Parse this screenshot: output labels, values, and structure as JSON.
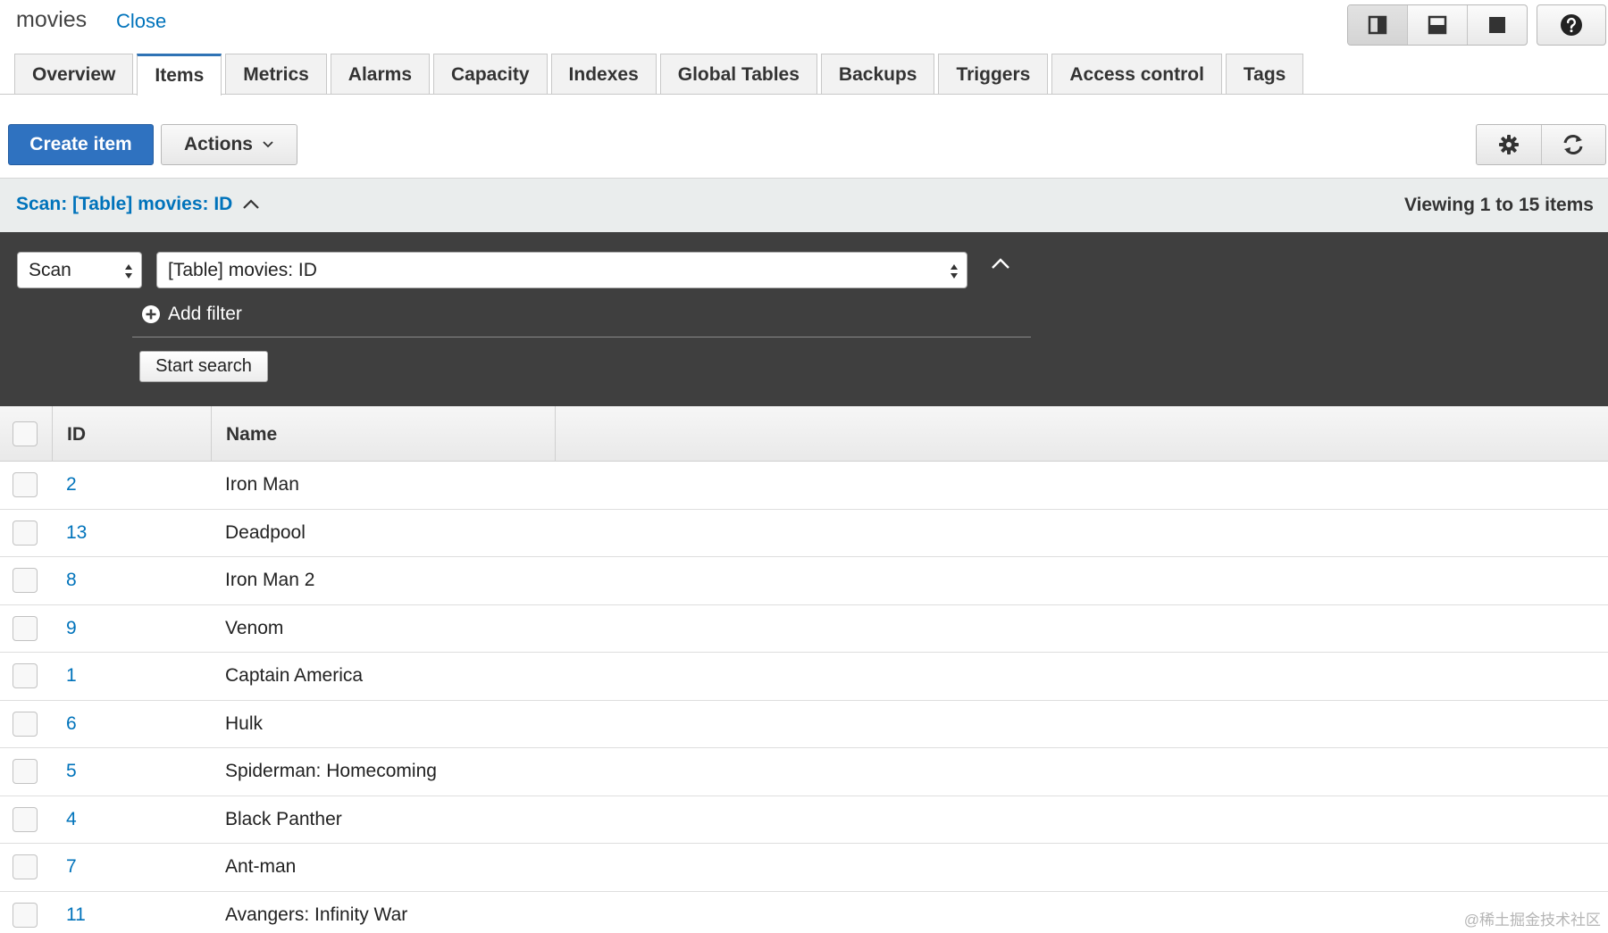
{
  "header": {
    "title": "movies",
    "close_label": "Close"
  },
  "tabs": [
    {
      "label": "Overview",
      "active": false
    },
    {
      "label": "Items",
      "active": true
    },
    {
      "label": "Metrics",
      "active": false
    },
    {
      "label": "Alarms",
      "active": false
    },
    {
      "label": "Capacity",
      "active": false
    },
    {
      "label": "Indexes",
      "active": false
    },
    {
      "label": "Global Tables",
      "active": false
    },
    {
      "label": "Backups",
      "active": false
    },
    {
      "label": "Triggers",
      "active": false
    },
    {
      "label": "Access control",
      "active": false
    },
    {
      "label": "Tags",
      "active": false
    }
  ],
  "toolbar": {
    "create_label": "Create item",
    "actions_label": "Actions"
  },
  "scan": {
    "title": "Scan: [Table] movies: ID",
    "viewing": "Viewing 1 to 15 items"
  },
  "search": {
    "mode": "Scan",
    "target": "[Table] movies: ID",
    "add_filter_label": "Add filter",
    "start_label": "Start search"
  },
  "table": {
    "columns": [
      "ID",
      "Name"
    ],
    "rows": [
      {
        "id": "2",
        "name": "Iron Man"
      },
      {
        "id": "13",
        "name": "Deadpool"
      },
      {
        "id": "8",
        "name": "Iron Man 2"
      },
      {
        "id": "9",
        "name": "Venom"
      },
      {
        "id": "1",
        "name": "Captain America"
      },
      {
        "id": "6",
        "name": "Hulk"
      },
      {
        "id": "5",
        "name": "Spiderman: Homecoming"
      },
      {
        "id": "4",
        "name": "Black Panther"
      },
      {
        "id": "7",
        "name": "Ant-man"
      },
      {
        "id": "11",
        "name": "Avangers: Infinity War"
      }
    ]
  },
  "watermark": "@稀土掘金技术社区",
  "colors": {
    "accent": "#2f72c0",
    "link": "#0073bb",
    "panel": "#3f3f3f"
  }
}
